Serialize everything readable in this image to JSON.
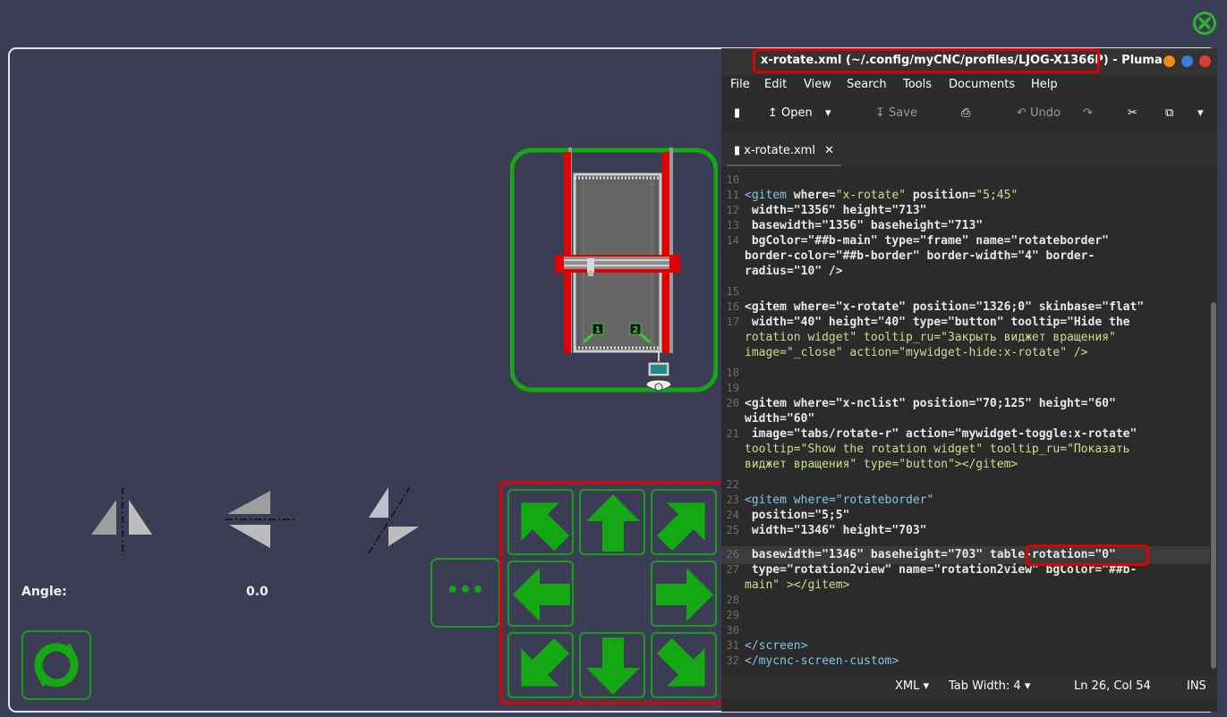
{
  "widget": {
    "angle_label": "Angle:",
    "angle_value": "0.0"
  },
  "machine": {
    "marker_1": "1",
    "marker_2": "2"
  },
  "jog": {
    "more_label": "•••",
    "buttons": [
      "up-left",
      "up",
      "up-right",
      "left",
      "right",
      "down-left",
      "down",
      "down-right"
    ]
  },
  "editor": {
    "title": "x-rotate.xml (~/.config/myCNC/profiles/LJOG-X1366P)",
    "app_suffix": " - Pluma",
    "menu": [
      "File",
      "Edit",
      "View",
      "Search",
      "Tools",
      "Documents",
      "Help"
    ],
    "toolbar": {
      "open": "Open",
      "save": "Save",
      "undo": "Undo"
    },
    "tab_label": "x-rotate.xml",
    "status": {
      "language": "XML",
      "tab_width": "Tab Width: 4",
      "position": "Ln 26, Col 54",
      "mode": "INS"
    },
    "line_numbers": [
      "10",
      "11",
      "12",
      "13",
      "14",
      "",
      "",
      "15",
      "16",
      "17",
      "",
      "",
      "18",
      "19",
      "20",
      "",
      "21",
      "",
      "",
      "22",
      "23",
      "24",
      "25",
      "26",
      "27",
      "",
      "28",
      "29",
      "30",
      "31",
      "32"
    ],
    "code": {
      "l10": "",
      "l11a": "<gitem ",
      "l11b": "where=",
      "l11c": "\"x-rotate\"",
      "l11d": " position=",
      "l11e": "\"5;45\"",
      "l12": " width=\"1356\" height=\"713\"",
      "l13": " basewidth=\"1356\" baseheight=\"713\"",
      "l14": " bgColor=\"##b-main\" type=\"frame\" name=\"rotateborder\"",
      "l14b": "border-color=\"##b-border\" border-width=\"4\" border-",
      "l14c": "radius=\"10\" />",
      "l15": "",
      "l16": "<gitem where=\"x-rotate\" position=\"1326;0\" skinbase=\"flat\"",
      "l17": " width=\"40\" height=\"40\" type=\"button\" tooltip=\"Hide the",
      "l17b": "rotation widget\" tooltip_ru=\"Закрыть виджет вращения\"",
      "l17c": "image=\"_close\" action=\"mywidget-hide:x-rotate\" />",
      "l18": "",
      "l19": "",
      "l20": "<gitem where=\"x-nclist\" position=\"70;125\" height=\"60\"",
      "l20b": "width=\"60\"",
      "l21": " image=\"tabs/rotate-r\" action=\"mywidget-toggle:x-rotate\"",
      "l21b": "tooltip=\"Show the rotation widget\" tooltip_ru=\"Показать",
      "l21c": "виджет вращения\" type=\"button\"></gitem>",
      "l22": "",
      "l23": "<gitem where=\"rotateborder\"",
      "l24": " position=\"5;5\"",
      "l25": " width=\"1346\" height=\"703\"",
      "l26": " basewidth=\"1346\" baseheight=\"703\" table-rotation=\"0\"",
      "l27": " type=\"rotation2view\" name=\"rotation2view\" bgColor=\"##b-",
      "l27b": "main\" ></gitem>",
      "l28": "",
      "l29": "",
      "l30": "",
      "l31": "</screen>",
      "l32": "</mycnc-screen-custom>"
    }
  },
  "colors": {
    "background": "#3b3d55",
    "accent_green": "#14a814",
    "highlight_red": "#e00000"
  }
}
